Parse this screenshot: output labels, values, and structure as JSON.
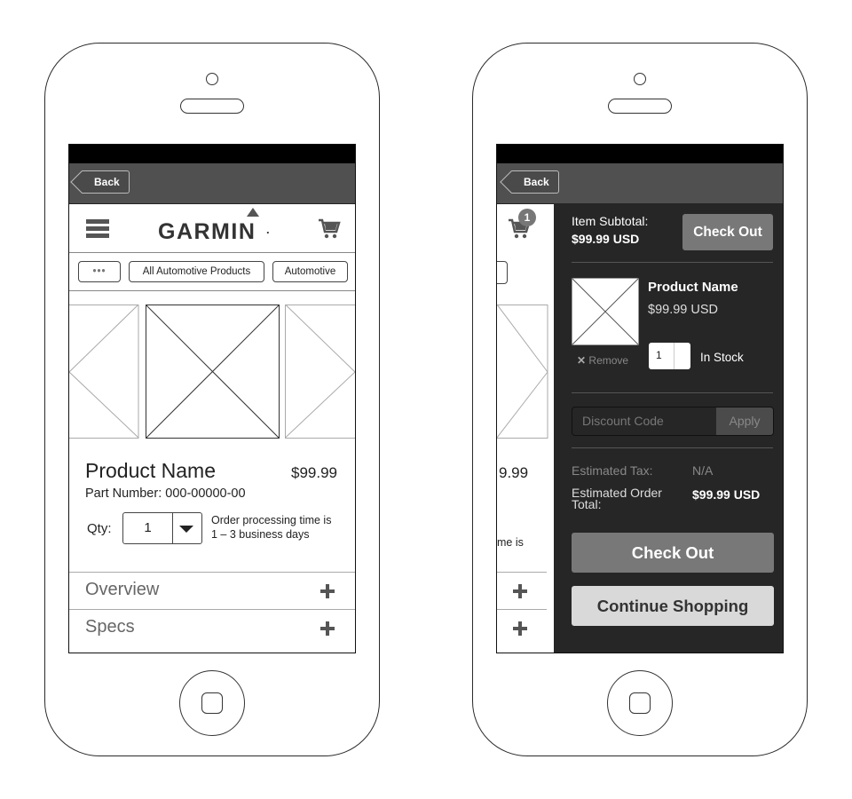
{
  "left_phone": {
    "nav": {
      "back_label": "Back"
    },
    "header": {
      "logo_text": "GARMIN",
      "menu_icon": "hamburger-icon",
      "cart_icon": "cart-icon"
    },
    "breadcrumbs": {
      "more_label": "•••",
      "items": [
        "All Automotive Products",
        "Automotive"
      ]
    },
    "product": {
      "name": "Product Name",
      "price": "$99.99",
      "part_number": "Part Number: 000-00000-00",
      "qty_label": "Qty:",
      "qty_value": "1",
      "processing_line1": "Order processing time is",
      "processing_line2": "1 – 3 business days"
    },
    "accordion": [
      {
        "label": "Overview"
      },
      {
        "label": "Specs"
      }
    ]
  },
  "right_phone": {
    "nav": {
      "back_label": "Back"
    },
    "cart_badge": "1",
    "background_peek": {
      "price_fragment": "9.99",
      "processing_fragment": "me is"
    },
    "cart_panel": {
      "subtotal_label": "Item Subtotal:",
      "subtotal_value": "$99.99 USD",
      "checkout_top_label": "Check Out",
      "item": {
        "name": "Product Name",
        "price": "$99.99 USD",
        "remove_label": "Remove",
        "qty_value": "1",
        "stock_status": "In Stock"
      },
      "discount": {
        "placeholder": "Discount Code",
        "apply_label": "Apply"
      },
      "tax_label": "Estimated Tax:",
      "tax_value": "N/A",
      "order_total_label_line1": "Estimated Order",
      "order_total_label_line2": "Total:",
      "order_total_value": "$99.99 USD",
      "checkout_label": "Check Out",
      "continue_label": "Continue Shopping"
    }
  },
  "colors": {
    "status_bar": "#000000",
    "nav_bar": "#505050",
    "cart_panel_bg": "#262626",
    "primary_button": "#787878",
    "secondary_button": "#d9d9d9"
  }
}
